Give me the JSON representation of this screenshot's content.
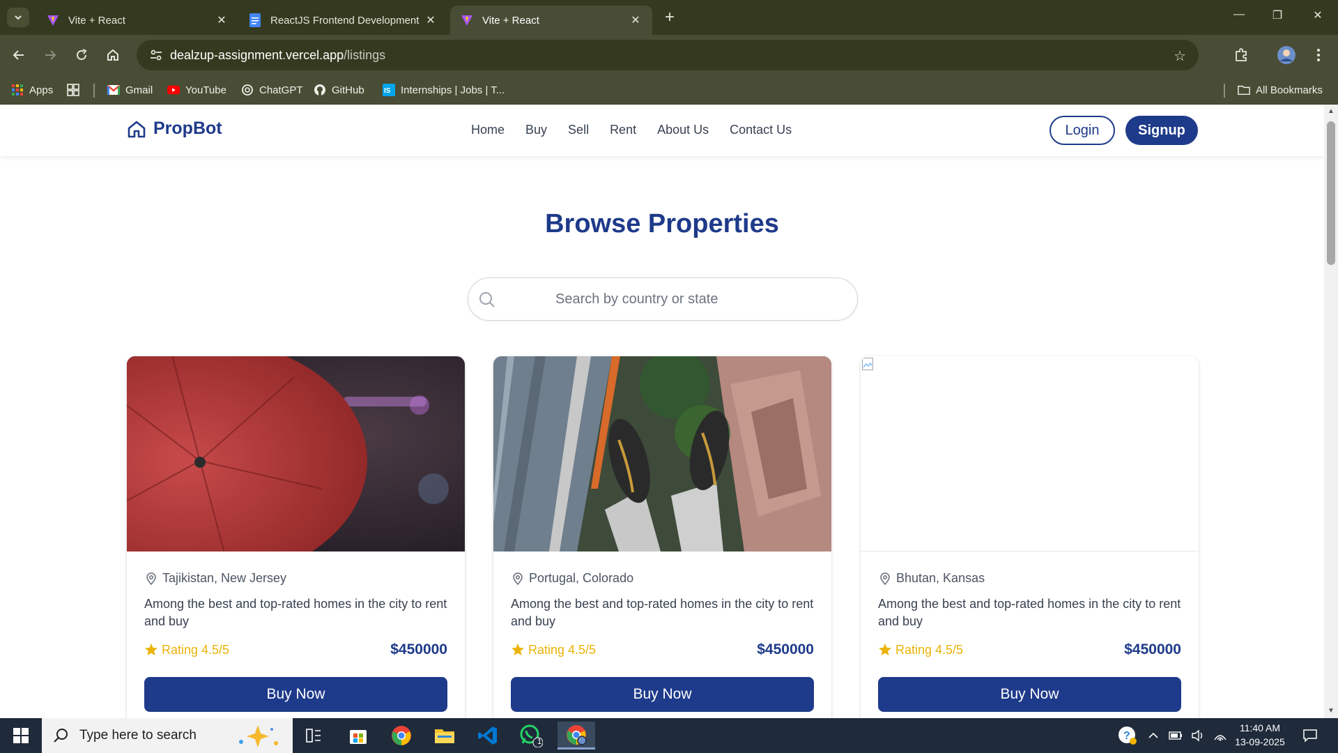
{
  "browser": {
    "tabs": [
      {
        "title": "Vite + React",
        "favicon": "vite-icon",
        "active": false
      },
      {
        "title": "ReactJS Frontend Development",
        "favicon": "docs-icon",
        "active": false
      },
      {
        "title": "Vite + React",
        "favicon": "vite-icon",
        "active": true
      }
    ],
    "url_host": "dealzup-assignment.vercel.app",
    "url_path": "/listings",
    "bookmarks": [
      {
        "label": "Apps",
        "icon": "apps-grid-icon"
      },
      {
        "label": "",
        "icon": "tab-groups-icon"
      },
      {
        "label": "Gmail",
        "icon": "gmail-icon"
      },
      {
        "label": "YouTube",
        "icon": "youtube-icon"
      },
      {
        "label": "ChatGPT",
        "icon": "chatgpt-icon"
      },
      {
        "label": "GitHub",
        "icon": "github-icon"
      },
      {
        "label": "Internships | Jobs | T...",
        "icon": "internshala-icon"
      }
    ],
    "all_bookmarks_label": "All Bookmarks"
  },
  "site": {
    "brand": "PropBot",
    "nav": [
      "Home",
      "Buy",
      "Sell",
      "Rent",
      "About Us",
      "Contact Us"
    ],
    "login_label": "Login",
    "signup_label": "Signup",
    "page_title": "Browse Properties",
    "search_placeholder": "Search by country or state",
    "listings": [
      {
        "location": "Tajikistan, New Jersey",
        "description": "Among the best and top-rated homes in the city to rent and buy",
        "rating": "Rating 4.5/5",
        "price": "$450000",
        "cta": "Buy Now",
        "image": "red-umbrella-photo"
      },
      {
        "location": "Portugal, Colorado",
        "description": "Among the best and top-rated homes in the city to rent and buy",
        "rating": "Rating 4.5/5",
        "price": "$450000",
        "cta": "Buy Now",
        "image": "rooftop-feet-photo"
      },
      {
        "location": "Bhutan, Kansas",
        "description": "Among the best and top-rated homes in the city to rent and buy",
        "rating": "Rating 4.5/5",
        "price": "$450000",
        "cta": "Buy Now",
        "image": "broken-image"
      }
    ]
  },
  "taskbar": {
    "search_text": "Type here to search",
    "time": "11:40 AM",
    "date": "13-09-2025",
    "whatsapp_badge": "1"
  },
  "colors": {
    "brand": "#1e3a8a",
    "rating": "#eab308",
    "chrome_frame": "#35391f",
    "chrome_toolbar": "#4a4d35"
  }
}
